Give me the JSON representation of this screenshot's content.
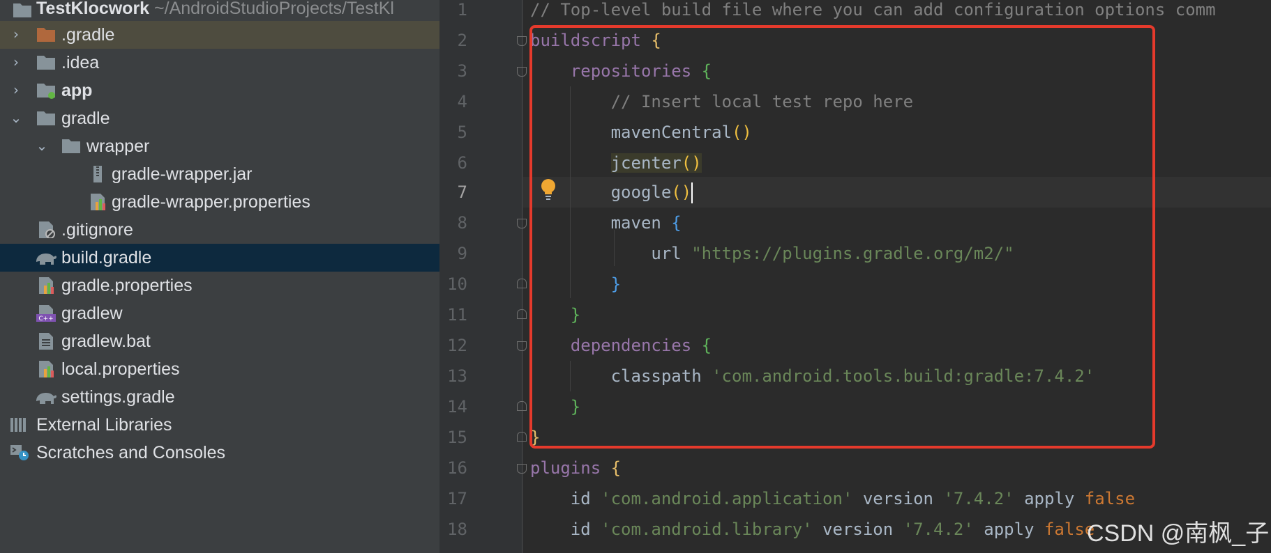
{
  "project_panel": {
    "root_label": "TestKlocwork",
    "root_path": "~/AndroidStudioProjects/TestKl",
    "items": [
      {
        "label": "gradle_dot",
        "text": ".gradle"
      },
      {
        "label": "idea",
        "text": ".idea"
      },
      {
        "label": "app",
        "text": "app"
      },
      {
        "label": "gradle",
        "text": "gradle"
      },
      {
        "label": "wrapper",
        "text": "wrapper"
      },
      {
        "label": "wrapper_jar",
        "text": "gradle-wrapper.jar"
      },
      {
        "label": "wrapper_props",
        "text": "gradle-wrapper.properties"
      },
      {
        "label": "gitignore",
        "text": ".gitignore"
      },
      {
        "label": "build_gradle",
        "text": "build.gradle"
      },
      {
        "label": "gradle_props",
        "text": "gradle.properties"
      },
      {
        "label": "gradlew",
        "text": "gradlew"
      },
      {
        "label": "gradlew_bat",
        "text": "gradlew.bat"
      },
      {
        "label": "local_props",
        "text": "local.properties"
      },
      {
        "label": "settings_gradle",
        "text": "settings.gradle"
      },
      {
        "label": "external_libs",
        "text": "External Libraries"
      },
      {
        "label": "scratches",
        "text": "Scratches and Consoles"
      }
    ]
  },
  "editor": {
    "line_numbers": [
      "1",
      "2",
      "3",
      "4",
      "5",
      "6",
      "7",
      "8",
      "9",
      "10",
      "11",
      "12",
      "13",
      "14",
      "15",
      "16",
      "17",
      "18"
    ],
    "current_line": "7",
    "code": {
      "l1": "// Top-level build file where you can add configuration options comm",
      "l2_kw": "buildscript",
      "l3_kw": "repositories",
      "l4": "// Insert local test repo here",
      "l5": "mavenCentral",
      "l6": "jcenter",
      "l7": "google",
      "l8": "maven",
      "l9_kw": "url",
      "l9_str": "\"https://plugins.gradle.org/m2/\"",
      "l12_kw": "dependencies",
      "l13_kw": "classpath",
      "l13_str": "'com.android.tools.build:gradle:7.4.2'",
      "l16_kw": "plugins",
      "l17_id": "id",
      "l17_str": "'com.android.application'",
      "l17_ver": "version",
      "l17_verstr": "'7.4.2'",
      "l17_apply": "apply",
      "l17_false": "false",
      "l18_id": "id",
      "l18_str": "'com.android.library'",
      "l18_ver": "version",
      "l18_verstr": "'7.4.2'",
      "l18_apply": "apply",
      "l18_false": "false"
    }
  },
  "watermark": "CSDN @南枫_子",
  "colors": {
    "annotation_box": "#e53a2c",
    "selection": "#0d293e"
  }
}
